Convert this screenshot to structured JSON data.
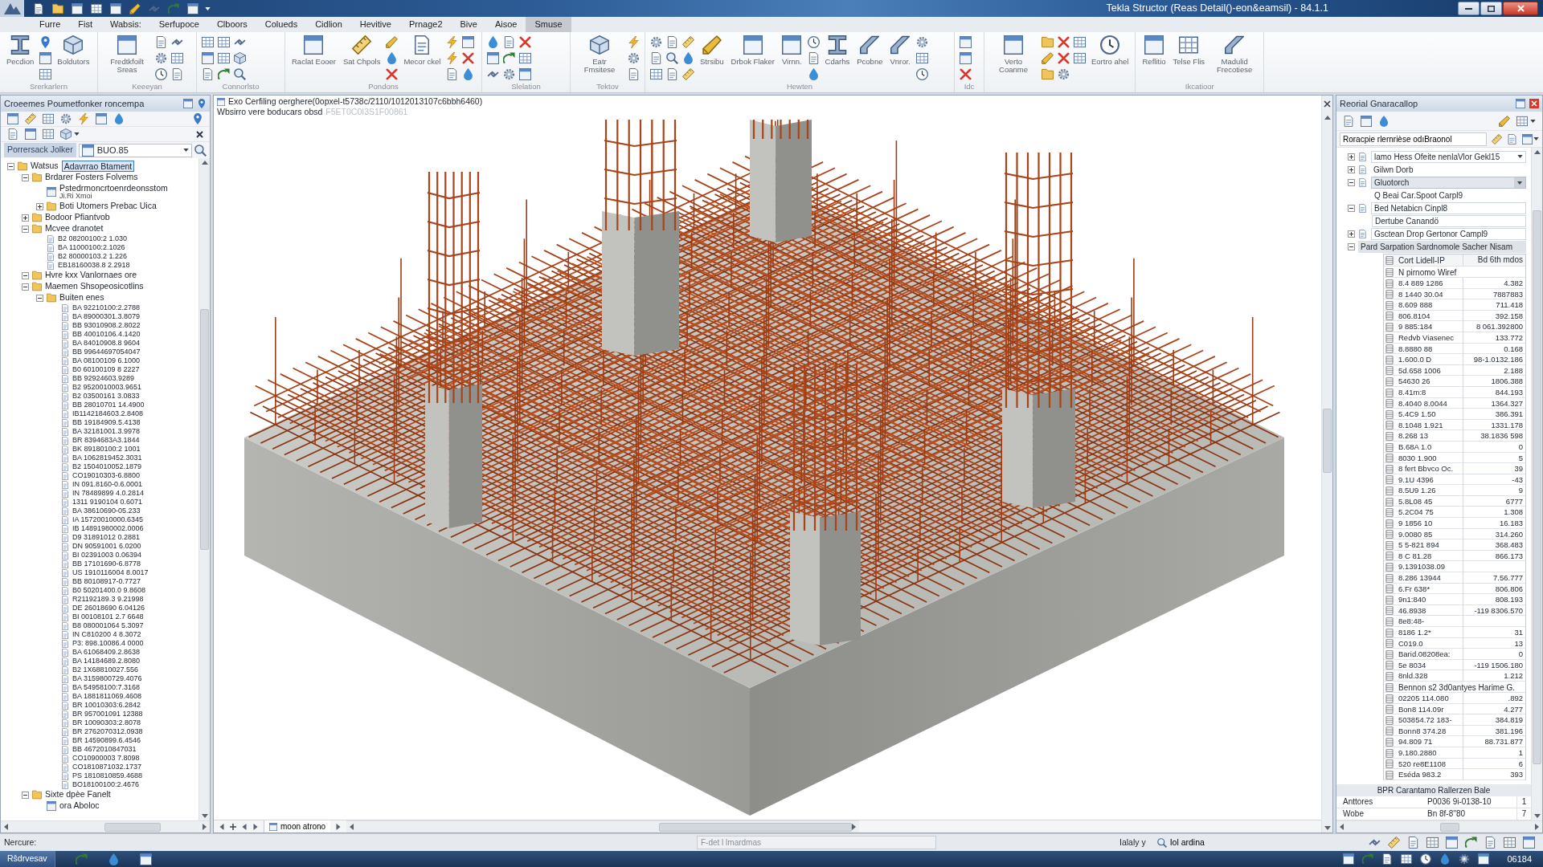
{
  "window": {
    "title": "Tekla Structor (Reas Detail()-eon&eamsil) - 84.1.1"
  },
  "ribbon_tabs": [
    {
      "label": "Furre",
      "selected": false
    },
    {
      "label": "Fist",
      "selected": false
    },
    {
      "label": "Wabsis:",
      "selected": false
    },
    {
      "label": "Serfupoce",
      "selected": false
    },
    {
      "label": "Clboors",
      "selected": false
    },
    {
      "label": "Colueds",
      "selected": false
    },
    {
      "label": "Cidlion",
      "selected": false
    },
    {
      "label": "Hevitive",
      "selected": false
    },
    {
      "label": "Prnage2",
      "selected": false
    },
    {
      "label": "Bive",
      "selected": false
    },
    {
      "label": "Aisoe",
      "selected": false
    },
    {
      "label": "Smuse",
      "selected": true
    }
  ],
  "ribbon_groups": [
    {
      "label": "Srerkarlern",
      "buttons": [
        "Pecdion",
        "Boldutors"
      ]
    },
    {
      "label": "Keeeyan",
      "buttons": [
        "Fredtkfoilt Sreas"
      ]
    },
    {
      "label": "Connorlsto"
    },
    {
      "label": "Pondons",
      "buttons": [
        "Raclat Eooer",
        "Sat Chpols",
        "Mecor ckel"
      ]
    },
    {
      "label": "Slelation"
    },
    {
      "label": "Tektov",
      "buttons": [
        "Eatr Fmsitese"
      ]
    },
    {
      "label": "Hewten",
      "buttons": [
        "Strsibu",
        "Drbok Flaker",
        "Virnn.",
        "Cdarhs",
        "Pcobne",
        "Vnror."
      ]
    },
    {
      "label": "Idc"
    },
    {
      "buttons": [
        "Verto Coanme",
        "Eortro ahel"
      ]
    },
    {
      "label": "Ikcatioor",
      "buttons": [
        "Reflitio",
        "Telse Flis",
        "Madulid Frecotiese"
      ]
    }
  ],
  "model_browser": {
    "title": "Croeemes Poumetfonker roncempa",
    "filter_label": "Porrersack Jolker",
    "filter_value": "BUO.85",
    "tree": [
      {
        "label": "Watsus",
        "rename_value": "Adavrrao Btament",
        "expanded": true,
        "children": [
          {
            "label": "Brdarer Fosters Folvems",
            "expanded": true,
            "children": [
              {
                "label": "Pstedrmoncrtoenrdeonsstom",
                "note": "Ji.Ri Xmoi"
              },
              {
                "label": "Boti Utomers Prebac Uica",
                "expanded": false
              }
            ]
          },
          {
            "label": "Bodoor Pfiantvob",
            "expanded": false
          },
          {
            "label": "Mcvee dranotet",
            "expanded": true,
            "parts": [
              "B2 08200100:2 1.030",
              "BA 11000100:2.1026",
              "B2 80000103.2 1.226",
              "EB18160038.8 2.2918"
            ]
          },
          {
            "label": "Hvre kxx Vanlornaes ore",
            "expanded": true
          },
          {
            "label": "Maemen Shsopeosicotlins",
            "expanded": true,
            "children": [
              {
                "label": "Buiten enes",
                "expanded": true,
                "parts": [
                  "BA 92210100:2.2788",
                  "BA 89000301.3.8079",
                  "BB 93010908.2.8022",
                  "BB 40010106.4.1420",
                  "BA 84010908.8 9604",
                  "BB 99644697054047",
                  "BA 08100109 6.1000",
                  "B0 60100109 8 2227",
                  "BB 92924603.9289",
                  "B2 9520010003.9651",
                  "B2 03500161 3.0833",
                  "BB 28010701 14.4900",
                  "IB1142184603.2.8408",
                  "BB 19184909.5.4138",
                  "BA 32181001.3.9978",
                  "BR 8394683A3.1844",
                  "BK 89180100:2 1001",
                  "BA 1062819452.3031",
                  "B2 1504010052.1879",
                  "CO19010303-6.8800",
                  "IN 091.8160-0.6.0001",
                  "IN 78489899 4.0.2814",
                  "1311 9190104 0.6071",
                  "BA 38610690-05.233",
                  "IA 15720010000.6345",
                  "IB 14891980002.0006",
                  "D9 31891012 0.2881",
                  "DN 90591001 6.0200",
                  "BI 02391003 0.06394",
                  "BB 17101690-6.8778",
                  "US 1910116004 8.0017",
                  "BB 80108917-0.7727",
                  "B0 50201400.0 9.8608",
                  "R21192189.3 9.21998",
                  "DE 26018690 6.04126",
                  "BI 00108101 2.7 6648",
                  "B8 080001064 5.3097",
                  "IN C810200 4 8.3072",
                  "P3: 898.10086.4 0000",
                  "BA 61068409.2.8638",
                  "BA 14184689.2.8080",
                  "B2 1X68810027.556",
                  "BA 3159800729.4076",
                  "BA 54958100:7.3168",
                  "BA 1881811069.4608",
                  "BR 10010303:6.2842",
                  "BR 957001091 12388",
                  "BR 10090303:2.8078",
                  "BR 2762070312.0938",
                  "BR 14590899.6.4546",
                  "BB 4672010847031",
                  "CO10900003 7.8098",
                  "CO1810871032.1737",
                  "PS 1810810859.4688",
                  "BO18100100:2.4676"
                ]
              }
            ]
          },
          {
            "label": "Sixte dpèe Fanelt",
            "expanded": true,
            "children": [
              {
                "label": "ora Aboloc"
              }
            ]
          }
        ]
      }
    ]
  },
  "viewport": {
    "title": "Exo Cerfiling oerghere(0opxel-t5738c/2110/1012013107c6bbh6460)",
    "caption": "Wbsirro vere boducars obsd",
    "caption_note": "F5ET0C0I3S1F00861",
    "view_tab": "moon atrono"
  },
  "properties": {
    "title": "Reorial Gnaracallop",
    "search": {
      "value": "Roracpie rlernrièse odıBraonol"
    },
    "items": [
      {
        "kind": "combo",
        "label": "lamo Hess Ofeite nenlaVlor Gekl15",
        "expanded": false
      },
      {
        "kind": "text",
        "label": "Gilwn Dorb",
        "expanded": false
      },
      {
        "kind": "dropdown",
        "label": "Gluotorch",
        "expanded": true,
        "children": [
          {
            "kind": "text",
            "label": "Q Beai Car.Spoot Carpl9"
          }
        ]
      },
      {
        "kind": "field",
        "label": "Bed Netabicn Cinpl8",
        "expanded": true,
        "children": [
          {
            "kind": "field",
            "label": "Dertube Canandö"
          }
        ]
      },
      {
        "kind": "field",
        "label": "Gsctean Drop Gertonor Campl9",
        "expanded": false
      },
      {
        "kind": "header",
        "label": "Pard Sarpation Sardnomole Sacher Nisam",
        "expanded": true
      }
    ],
    "table": {
      "columns": [
        "Cort Lidell-IP",
        "Bd 6th mdos"
      ],
      "groups": [
        {
          "label": "N pirnomo Wiref",
          "rows": [
            [
              "8.4 889 1286",
              "4.382"
            ],
            [
              "8 1440 30.04",
              "7887883"
            ],
            [
              "8.609 888",
              "711.418"
            ],
            [
              "806.8104",
              "392.158"
            ],
            [
              "9 885:184",
              "8 061.392800"
            ],
            [
              "Redvb Viasenec",
              "133.772"
            ],
            [
              "8.8880 88",
              "0.168"
            ],
            [
              "1.600.0 D",
              "98-1.0132.186"
            ],
            [
              "5d.658 1006",
              "2.188"
            ],
            [
              "54630 26",
              "1806.388"
            ],
            [
              "8.41m:8",
              "844.193"
            ],
            [
              "8.4040 8.0044",
              "1364.327"
            ],
            [
              "5.4C9 1.50",
              "386.391"
            ],
            [
              "8.1048 1.921",
              "1331.178"
            ],
            [
              "8.268 13",
              "38.1836 598"
            ],
            [
              "B.68A 1.0",
              "0"
            ],
            [
              "8030 1.900",
              "5"
            ],
            [
              "8 fert Bbvco Oc.",
              "39"
            ],
            [
              "9.1U 4396",
              "-43"
            ],
            [
              "8.5U9 1.26",
              "9"
            ],
            [
              "5.8L08 45",
              "6777"
            ],
            [
              "5.2C04 75",
              "1.308"
            ],
            [
              "9 1856 10",
              "16.183"
            ],
            [
              "9.0080 85",
              "314.260"
            ],
            [
              "5 5-821 894",
              "368.483"
            ],
            [
              "8 C 81.28",
              "866.173"
            ],
            [
              "9.1391038.09"
            ],
            [
              "8.286 13944",
              "7.56.777"
            ],
            [
              "6.Fr 638*",
              "806.806"
            ],
            [
              "9n1:840",
              "808.193"
            ],
            [
              "46.8938",
              "-119 8306.570"
            ],
            [
              "8e8:48-"
            ],
            [
              "8186 1.2*",
              "31"
            ],
            [
              "C019.0",
              "13"
            ],
            [
              "Barid.08208ea:",
              "0"
            ],
            [
              "5e 8034",
              "-119 1506.180"
            ],
            [
              "8nld.328",
              "1.212"
            ]
          ]
        },
        {
          "label": "Bennon s2 3d0antyes Harime G.",
          "rows": [
            [
              "02205 114.080",
              ".892"
            ],
            [
              "Bon8 114.09r",
              "4.277"
            ],
            [
              "503854.72 183-",
              "384.819"
            ],
            [
              "Bonn8 374.28",
              "381.196"
            ],
            [
              "94.809 71",
              "88.731.877"
            ],
            [
              "9.180.2880",
              "1"
            ],
            [
              "520 re8E1108",
              "6"
            ],
            [
              "Eséda 983.2",
              "393"
            ]
          ]
        }
      ]
    },
    "footer": {
      "title": "BPR Carantamo Rallerzen Bale",
      "rows": [
        [
          "Anttores",
          "P0036 9i-0138-10",
          "1"
        ],
        [
          "Wobe",
          "Bn 8f-8''80",
          "7"
        ]
      ]
    }
  },
  "status_bar": {
    "prompt": "Nercure:",
    "command": {
      "placeholder": "F-det l lmardmas"
    },
    "mode": "Ialaly y",
    "snap": "Iol ardina"
  },
  "taskbar": {
    "start": "Rŝdrvesav",
    "clock": "06184"
  }
}
